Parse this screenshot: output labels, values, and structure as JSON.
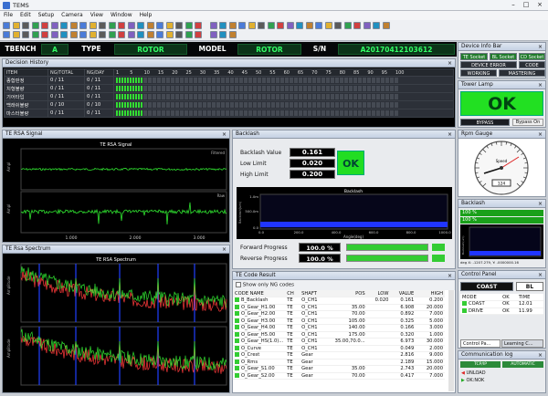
{
  "window": {
    "title": "TEMS"
  },
  "menu": [
    "File",
    "Edit",
    "Setup",
    "Camera",
    "View",
    "Window",
    "Help"
  ],
  "info": {
    "tbench_label": "TBENCH",
    "tbench_value": "A",
    "type_label": "TYPE",
    "type_value": "ROTOR",
    "model_label": "MODEL",
    "model_value": "ROTOR",
    "sn_label": "S/N",
    "sn_value": "A20170412103612"
  },
  "decision": {
    "title": "Decision History",
    "headers": [
      "ITEM",
      "NG/TOTAL",
      "NG/DAY",
      "1",
      "5",
      "10",
      "15",
      "20",
      "25",
      "30",
      "35",
      "40",
      "45",
      "50",
      "55",
      "60",
      "65",
      "70",
      "75",
      "80",
      "85",
      "90",
      "95",
      "100"
    ],
    "rows": [
      {
        "item": "종합판정",
        "total": "0 / 11",
        "day": "0 / 11"
      },
      {
        "item": "치형불량",
        "total": "0 / 11",
        "day": "0 / 11"
      },
      {
        "item": "기어타입",
        "total": "0 / 11",
        "day": "0 / 11"
      },
      {
        "item": "백래쉬불량",
        "total": "0 / 10",
        "day": "0 / 10"
      },
      {
        "item": "마스터불량",
        "total": "0 / 11",
        "day": "0 / 11"
      }
    ]
  },
  "rsa_signal": {
    "title": "TE RSA Signal",
    "chart_title": "TE RSA Signal",
    "ylabel": "Ampl",
    "xticks": [
      "1.000",
      "2.000",
      "3.000"
    ],
    "trace1": "Filtered",
    "trace2": "Raw"
  },
  "spectrum": {
    "title": "TE Rsa Spectrum",
    "chart_title": "TE RSA Spectrum",
    "ylabel": "Amplitude"
  },
  "backlash": {
    "title": "Backlash",
    "value_label": "Backlash Value",
    "value": "0.161",
    "low_label": "Low Limit",
    "low": "0.020",
    "high_label": "High Limit",
    "high": "0.200",
    "result": "OK",
    "chart_title": "Backlash",
    "ylabel": "Backlash(um)",
    "yticks": [
      "1.0m",
      "500.0m",
      "0.0"
    ],
    "xticks": [
      "0.0",
      "200.0",
      "400.0",
      "600.0",
      "800.0",
      "1000.0"
    ],
    "xlabel": "Angle(deg)",
    "forward_label": "Forward Progress",
    "forward_value": "100.0 %",
    "reverse_label": "Reverse Progress",
    "reverse_value": "100.0 %"
  },
  "code_result": {
    "title": "TE Code Result",
    "ng_only_label": "Show only NG codes",
    "headers": [
      "CODE NAME",
      "CH",
      "SHAFT",
      "POS",
      "LOW",
      "VALUE",
      "HIGH"
    ],
    "rows": [
      {
        "name": "B_Backlash",
        "ch": "TE",
        "shaft": "O_CH1",
        "pos": "",
        "low": "0.020",
        "value": "0.161",
        "high": "0.200"
      },
      {
        "name": "O_Gear_H1.00",
        "ch": "TE",
        "shaft": "O_CH1",
        "pos": "35.00",
        "low": "",
        "value": "6.908",
        "high": "20.000"
      },
      {
        "name": "O_Gear_H2.00",
        "ch": "TE",
        "shaft": "O_CH1",
        "pos": "70.00",
        "low": "",
        "value": "0.892",
        "high": "7.000"
      },
      {
        "name": "O_Gear_H3.00",
        "ch": "TE",
        "shaft": "O_CH1",
        "pos": "105.00",
        "low": "",
        "value": "0.325",
        "high": "5.000"
      },
      {
        "name": "O_Gear_H4.00",
        "ch": "TE",
        "shaft": "O_CH1",
        "pos": "140.00",
        "low": "",
        "value": "0.166",
        "high": "3.000"
      },
      {
        "name": "O_Gear_H5.00",
        "ch": "TE",
        "shaft": "O_CH1",
        "pos": "175.00",
        "low": "",
        "value": "0.320",
        "high": "1.000"
      },
      {
        "name": "O_Gear_HS(1.0)...",
        "ch": "TE",
        "shaft": "O_CH1",
        "pos": "35.00,70.0...",
        "low": "",
        "value": "6.973",
        "high": "30.000"
      },
      {
        "name": "O_Curve",
        "ch": "TE",
        "shaft": "O_CH1",
        "pos": "",
        "low": "",
        "value": "0.049",
        "high": "2.000"
      },
      {
        "name": "O_Crest",
        "ch": "TE",
        "shaft": "Gear",
        "pos": "",
        "low": "",
        "value": "2.816",
        "high": "9.000"
      },
      {
        "name": "O_Rms",
        "ch": "TE",
        "shaft": "Gear",
        "pos": "",
        "low": "",
        "value": "2.189",
        "high": "15.000"
      },
      {
        "name": "O_Gear_S1.00",
        "ch": "TE",
        "shaft": "Gear",
        "pos": "35.00",
        "low": "",
        "value": "2.743",
        "high": "20.000"
      },
      {
        "name": "O_Gear_S2.00",
        "ch": "TE",
        "shaft": "Gear",
        "pos": "70.00",
        "low": "",
        "value": "0.417",
        "high": "7.000"
      }
    ]
  },
  "device": {
    "title": "Device Info Bar",
    "tags": [
      "TE Socket",
      "BL Socket",
      "CD Socket"
    ],
    "error_label": "DEVICE ERROR",
    "code_label": "CODE",
    "working_label": "WORKING",
    "master_label": "MASTERING"
  },
  "tower": {
    "title": "Tower Lamp",
    "status": "OK",
    "bypass_label": "BYPASS",
    "bypass_on_label": "Bypass On"
  },
  "rpm": {
    "title": "Rpm Gauge",
    "readout": "124",
    "label": "Speed"
  },
  "bl_mini": {
    "title": "Backlash",
    "bar1": "100 %",
    "bar2": "100 %",
    "ylabel": "Backlash(um)",
    "readout": "deg X: -1207.279, Y: -0000000.16"
  },
  "control": {
    "title": "Control Panel",
    "coast_label": "COAST",
    "bl_label": "BL",
    "headers": [
      "MODE",
      "OK",
      "TIME"
    ],
    "rows": [
      {
        "mode": "COAST",
        "ok": "OK",
        "time": "12.01"
      },
      {
        "mode": "DRIVE",
        "ok": "OK",
        "time": "11.99"
      }
    ],
    "tab1": "Control Pa...",
    "tab2": "Learning C..."
  },
  "comm": {
    "title": "Communication log",
    "left_header": "TCP/IP",
    "right_header": "AUTOMATIC",
    "lines": [
      "UNLOAD",
      "OK:NOK"
    ]
  },
  "colors": {
    "signal": "#2fe02f",
    "spectrum_red": "#ff3b3b",
    "spectrum_green": "#30e030",
    "marker": "#2040ff",
    "ok_green": "#22dd22"
  }
}
